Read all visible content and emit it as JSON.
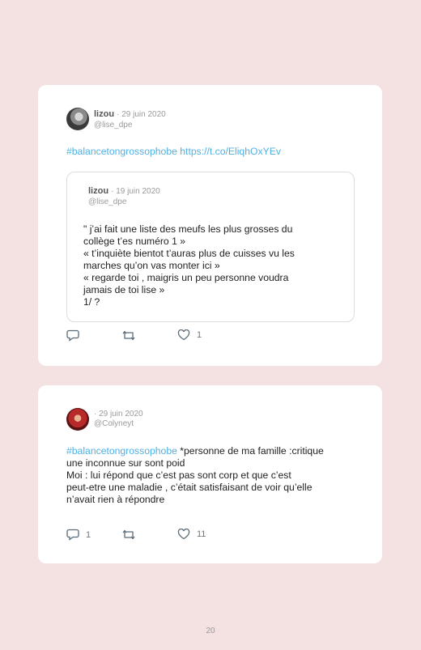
{
  "tweet1": {
    "author": "lizou",
    "date": "· 29 juin 2020",
    "handle": "@lise_dpe",
    "hashtag": "#balancetongrossophobe",
    "url": "https://t.co/EliqhOxYEv",
    "quote": {
      "author": "lizou",
      "date": "· 19 juin 2020",
      "handle": "@lise_dpe",
      "text": "\" j’ai fait une liste des meufs les plus grosses du\ncollège t’es numéro 1 »\n« t’inquiète bientot t’auras plus de cuisses vu les\nmarches qu’on vas monter ici »\n« regarde toi , maigris un peu personne voudra\njamais de toi lise »\n1/ ?"
    },
    "replies": "",
    "retweets": "",
    "likes": "1"
  },
  "tweet2": {
    "author": "",
    "date": "· 29 juin 2020",
    "handle": "@Colyneyt",
    "hashtag": "#balancetongrossophobe",
    "text_after_hashtag": " *personne de ma famille :critique\nune inconnue sur sont poid\nMoi : lui répond que c’est pas sont corp et que c’est\npeut-etre une maladie , c’était satisfaisant de voir qu’elle\nn’avait rien à répondre",
    "replies": "1",
    "retweets": "",
    "likes": "11"
  },
  "page_number": "20",
  "icons": {
    "reply": "reply-icon",
    "retweet": "retweet-icon",
    "like": "heart-icon"
  },
  "colors": {
    "background": "#f4e1e2",
    "card": "#ffffff",
    "link": "#4fb0e3"
  }
}
